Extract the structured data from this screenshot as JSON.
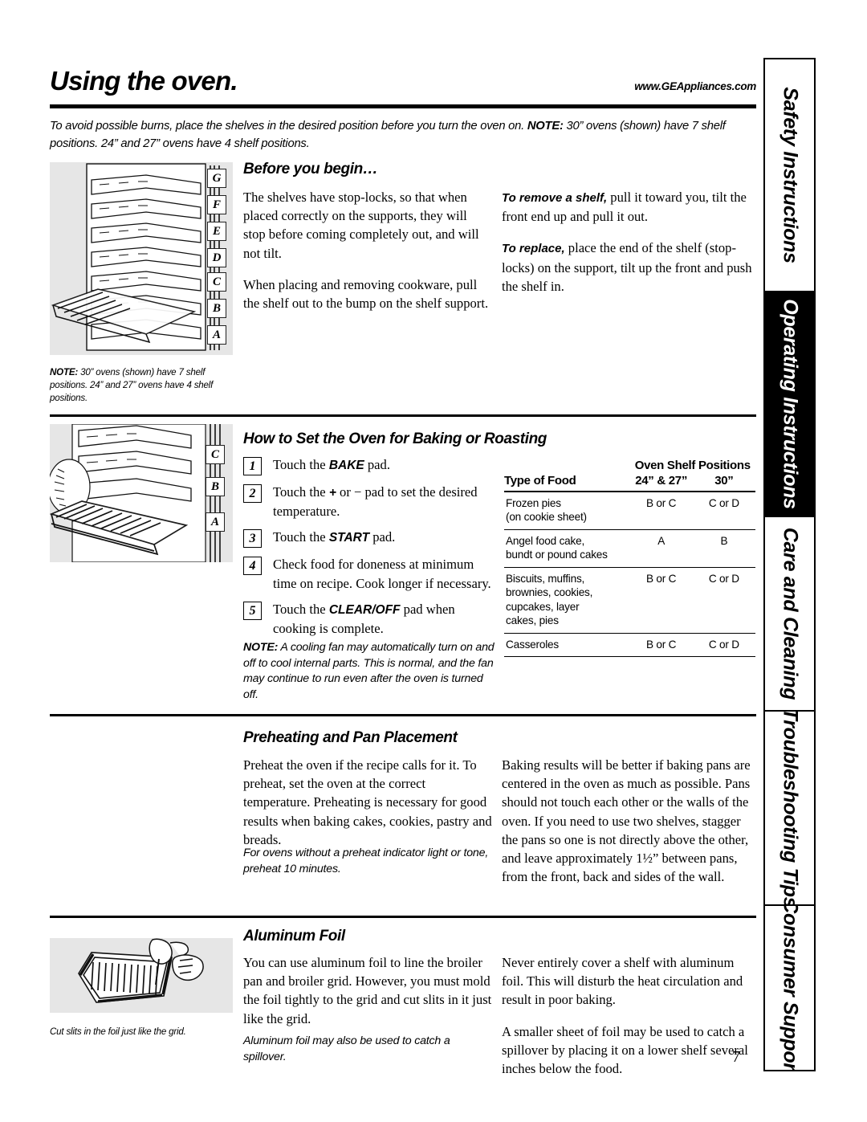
{
  "header": {
    "title": "Using the oven.",
    "url": "www.GEAppliances.com",
    "intro_pre": "To avoid possible burns, place the shelves in the desired position before you turn the oven on. ",
    "intro_note_label": "NOTE:",
    "intro_post": " 30” ovens (shown) have 7 shelf positions. 24” and 27” ovens have 4 shelf positions."
  },
  "tabs": [
    {
      "label": "Safety Instructions",
      "active": false
    },
    {
      "label": "Operating Instructions",
      "active": true
    },
    {
      "label": "Care and Cleaning",
      "active": false
    },
    {
      "label": "Troubleshooting Tips",
      "active": false
    },
    {
      "label": "Consumer Support",
      "active": false
    }
  ],
  "illustrations": {
    "oven_shelves": {
      "name": "oven-interior-seven-shelf-positions",
      "letters": [
        "G",
        "F",
        "E",
        "D",
        "C",
        "B",
        "A"
      ],
      "caption_note_label": "NOTE:",
      "caption_text": " 30” ovens (shown) have 7 shelf positions. 24” and 27” ovens have 4 shelf positions."
    },
    "oven_shelf_closeup": {
      "name": "oven-shelf-closeup-with-food",
      "letters": [
        "C",
        "B",
        "A"
      ]
    },
    "broiler_pan": {
      "name": "hand-cutting-slits-in-foil-on-broiler-grid",
      "caption": "Cut slits in the foil just like the grid."
    }
  },
  "sections": {
    "before_you_begin": {
      "heading": "Before you begin…",
      "left_paragraphs": [
        "The shelves have stop-locks, so that when placed correctly on the supports, they will stop before coming completely out, and will not tilt.",
        "When placing and removing cookware, pull the shelf out to the bump on the shelf support."
      ],
      "right_paragraphs": [
        {
          "lead": "To remove a shelf,",
          "text": " pull it toward you, tilt the front end up and pull it out."
        },
        {
          "lead": "To replace,",
          "text": " place the end of the shelf (stop-locks) on the support, tilt up the front and push the shelf in."
        }
      ]
    },
    "how_to_set": {
      "heading": "How to Set the Oven for Baking or Roasting",
      "steps": [
        {
          "num": "1",
          "pre": "Touch the ",
          "bold": "BAKE",
          "post": " pad."
        },
        {
          "num": "2",
          "pre": "Touch the ",
          "bold": "+",
          "post": " or − pad to set the desired temperature."
        },
        {
          "num": "3",
          "pre": "Touch the ",
          "bold": "START",
          "post": " pad."
        },
        {
          "num": "4",
          "pre": "Check food for doneness at minimum time on recipe. Cook longer if necessary.",
          "bold": "",
          "post": ""
        },
        {
          "num": "5",
          "pre": "Touch the ",
          "bold": "CLEAR/OFF",
          "post": " pad when cooking is complete."
        }
      ],
      "note_label": "NOTE:",
      "note_text": " A cooling fan may automatically turn on and off to cool internal parts. This is normal, and the fan may continue to run even after the oven is turned off."
    },
    "preheating": {
      "heading": "Preheating and Pan Placement",
      "left_paragraph": "Preheat the oven if the recipe calls for it. To preheat, set the oven at the correct temperature. Preheating is necessary for good results when baking cakes, cookies, pastry and breads.",
      "left_note": "For ovens without a preheat indicator light or tone, preheat 10 minutes.",
      "right_paragraph": "Baking results will be better if baking pans are centered in the oven as much as possible. Pans should not touch each other or the walls of the oven. If you need to use two shelves, stagger the pans so one is not directly above the other, and leave approximately 1½” between pans, from the front, back and sides of the wall."
    },
    "aluminum_foil": {
      "heading": "Aluminum Foil",
      "left_paragraph": "You can use aluminum foil to line the broiler pan and broiler grid. However, you must mold the foil tightly to the grid and cut slits in it just like the grid.",
      "left_note": "Aluminum foil may also be used to catch a spillover.",
      "right_paragraphs": [
        "Never entirely cover a shelf with aluminum foil. This will disturb the heat circulation and result in poor baking.",
        "A smaller sheet of foil may be used to catch a spillover by placing it on a lower shelf several inches below the food."
      ]
    }
  },
  "shelf_table": {
    "group_header": "Oven Shelf Positions",
    "columns": [
      "Type of Food",
      "24” & 27”",
      "30”"
    ],
    "rows": [
      {
        "food": "Frozen pies\n(on cookie sheet)",
        "c24": "B or C",
        "c30": "C or D"
      },
      {
        "food": "Angel food cake,\nbundt or pound cakes",
        "c24": "A",
        "c30": "B"
      },
      {
        "food": "Biscuits, muffins,\nbrownies, cookies,\ncupcakes, layer\ncakes, pies",
        "c24": "B or C",
        "c30": "C or D"
      },
      {
        "food": "Casseroles",
        "c24": "B or C",
        "c30": "C or D"
      }
    ]
  },
  "page_number": "7",
  "colors": {
    "ink": "#000000",
    "illus_bg": "#e6e6e6",
    "tab_active_bg": "#000000"
  }
}
